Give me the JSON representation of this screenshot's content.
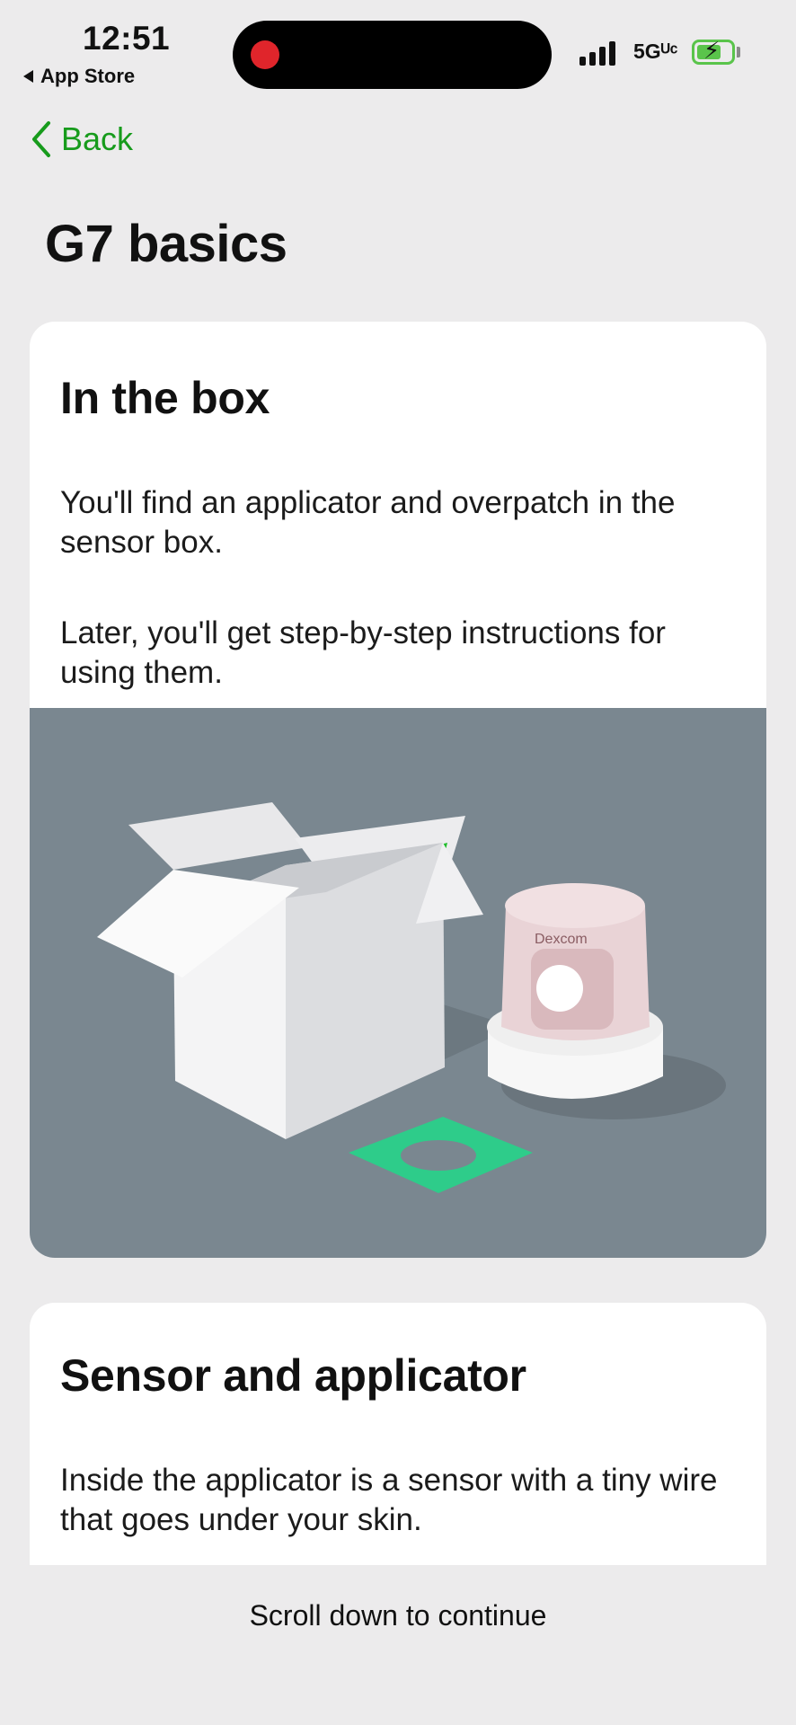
{
  "status_bar": {
    "time": "12:51",
    "back_app_label": "App Store",
    "network": "5Gᵁᶜ",
    "icons": [
      "record-icon",
      "signal-icon",
      "battery-charging-icon"
    ]
  },
  "nav": {
    "back_label": "Back"
  },
  "page_title": "G7 basics",
  "cards": [
    {
      "heading": "In the box",
      "paragraphs": [
        "You'll find an applicator and overpatch in the sensor box.",
        "Later, you'll get step-by-step instructions for using them."
      ],
      "illustration_brand": "Dexcom"
    },
    {
      "heading": "Sensor and applicator",
      "paragraphs": [
        "Inside the applicator is a sensor with a tiny wire that goes under your skin."
      ]
    }
  ],
  "footer": {
    "hint": "Scroll down to continue"
  },
  "colors": {
    "accent_green": "#179b1c",
    "background": "#ecebec",
    "illustration_bg": "#7a8790",
    "overpatch_green": "#2ecc8a"
  }
}
